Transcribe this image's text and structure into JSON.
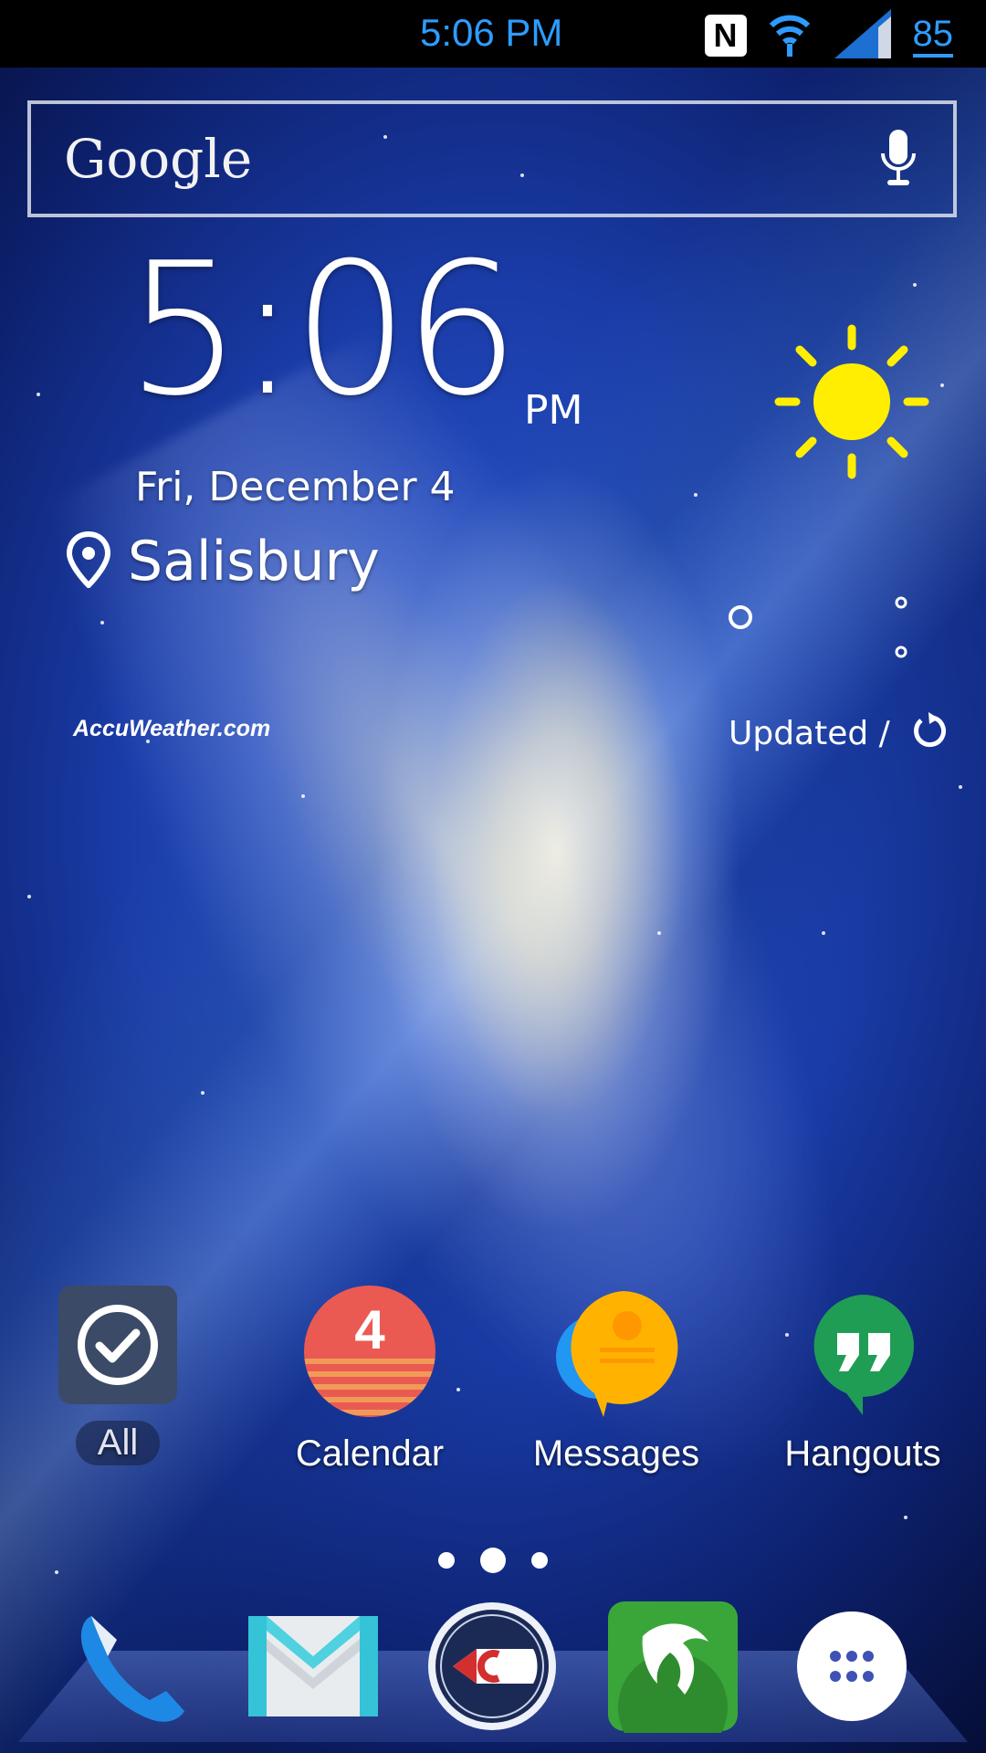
{
  "status_bar": {
    "time": "5:06 PM",
    "nfc_glyph": "N",
    "battery": "85",
    "icons": [
      "nfc-icon",
      "wifi-icon",
      "signal-icon"
    ],
    "accent_color": "#2e9cff"
  },
  "search": {
    "logo_text": "Google",
    "icons": [
      "mic-icon"
    ]
  },
  "clock": {
    "time": "5:06",
    "ampm": "PM",
    "date": "Fri, December 4",
    "location": "Salisbury"
  },
  "weather": {
    "provider": "AccuWeather.com",
    "updated_label": "Updated  /",
    "condition_icon": "sun-icon",
    "sun_color": "#ffee00"
  },
  "apps": [
    {
      "label": "All",
      "icon": "check-icon"
    },
    {
      "label": "Calendar",
      "icon": "calendar-icon",
      "badge": "4"
    },
    {
      "label": "Messages",
      "icon": "messages-icon"
    },
    {
      "label": "Hangouts",
      "icon": "hangouts-icon"
    }
  ],
  "page_indicator": {
    "pages": 3,
    "current": 2
  },
  "dock": [
    {
      "name": "phone",
      "icon": "phone-icon"
    },
    {
      "name": "email",
      "icon": "email-icon"
    },
    {
      "name": "chiefs",
      "icon": "chiefs-logo-icon"
    },
    {
      "name": "dolphin",
      "icon": "dolphin-browser-icon"
    },
    {
      "name": "app-drawer",
      "icon": "app-drawer-icon"
    }
  ]
}
